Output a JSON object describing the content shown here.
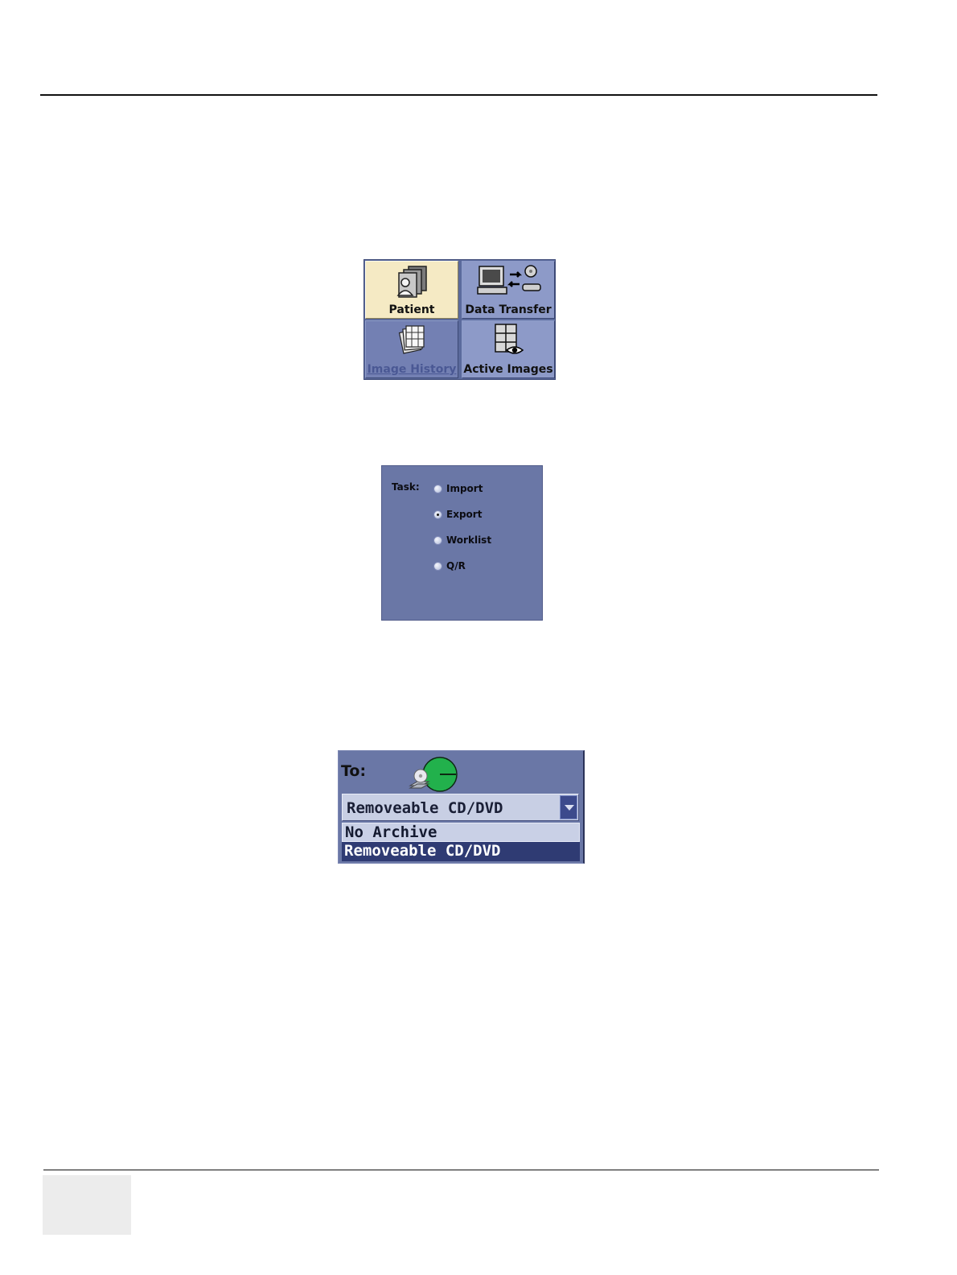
{
  "menu": {
    "tiles": [
      {
        "label": "Patient",
        "icon": "patient-folders-icon",
        "state": "selected"
      },
      {
        "label": "Data Transfer",
        "icon": "data-transfer-icon",
        "state": "normal"
      },
      {
        "label": "Image History",
        "icon": "image-history-icon",
        "state": "disabled"
      },
      {
        "label": "Active Images",
        "icon": "active-images-icon",
        "state": "normal"
      }
    ]
  },
  "task": {
    "label": "Task:",
    "options": [
      {
        "label": "Import",
        "checked": false
      },
      {
        "label": "Export",
        "checked": true
      },
      {
        "label": "Worklist",
        "checked": false
      },
      {
        "label": "Q/R",
        "checked": false
      }
    ]
  },
  "destination": {
    "label": "To:",
    "icon": "removable-media-capacity-icon",
    "selected": "Removeable CD/DVD",
    "options": [
      "No Archive",
      "Removeable CD/DVD"
    ],
    "highlighted_option": "Removeable CD/DVD"
  },
  "colors": {
    "panel_bg": "#6a77a6",
    "tile_selected": "#f5eac4",
    "capacity_green": "#22b14c",
    "highlight": "#2f3b73"
  }
}
